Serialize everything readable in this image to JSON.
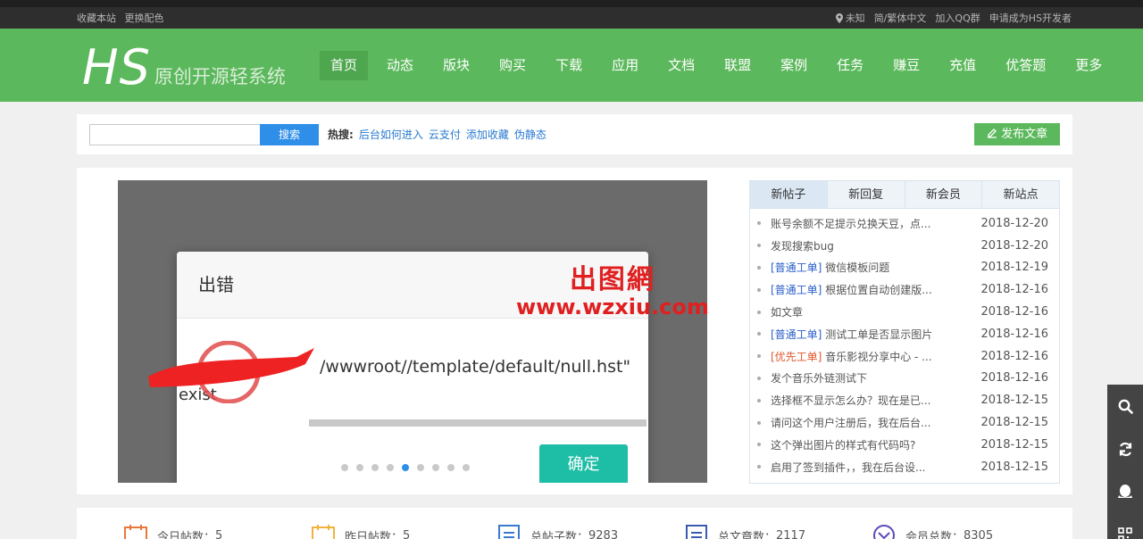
{
  "topbar": {
    "left": [
      "收藏本站",
      "更换配色"
    ],
    "location": "未知",
    "right": [
      "简/繁体中文",
      "加入QQ群",
      "申请成为HS开发者"
    ]
  },
  "logo": {
    "mark": "HS",
    "tagline": "原创开源轻系统"
  },
  "nav": [
    "首页",
    "动态",
    "版块",
    "购买",
    "下载",
    "应用",
    "文档",
    "联盟",
    "案例",
    "任务",
    "赚豆",
    "充值",
    "优答题",
    "更多"
  ],
  "search": {
    "placeholder": "",
    "button": "搜索",
    "hot_label": "热搜:",
    "hot_keywords": [
      "后台如何进入",
      "云支付",
      "添加收藏",
      "伪静态"
    ],
    "post_button": "发布文章"
  },
  "slider": {
    "dialog_title": "出错",
    "dialog_message": "/wwwroot//template/default/null.hst\"",
    "dialog_message_2": "exist",
    "ok_button": "确定",
    "dots_total": 9,
    "dots_active_index": 4,
    "watermark_1": "出图網",
    "watermark_2": "www.wzxiu.com"
  },
  "tabs": {
    "labels": [
      "新帖子",
      "新回复",
      "新会员",
      "新站点"
    ],
    "posts": [
      {
        "cat": "",
        "title": "账号余额不足提示兑换天豆，点...",
        "date": "2018-12-20"
      },
      {
        "cat": "",
        "title": "发现搜索bug",
        "date": "2018-12-20"
      },
      {
        "cat": "[普通工单]",
        "title": " 微信模板问题",
        "date": "2018-12-19"
      },
      {
        "cat": "[普通工单]",
        "title": " 根据位置自动创建版...",
        "date": "2018-12-16"
      },
      {
        "cat": "",
        "title": "如文章",
        "date": "2018-12-16"
      },
      {
        "cat": "[普通工单]",
        "title": " 测试工单是否显示图片",
        "date": "2018-12-16"
      },
      {
        "cat": "[优先工单]",
        "title": " 音乐影视分享中心 - ...",
        "date": "2018-12-16",
        "priority": true
      },
      {
        "cat": "",
        "title": "发个音乐外链测试下",
        "date": "2018-12-16"
      },
      {
        "cat": "",
        "title": "选择框不显示怎么办？现在是已...",
        "date": "2018-12-15"
      },
      {
        "cat": "",
        "title": "请问这个用户注册后，我在后台...",
        "date": "2018-12-15"
      },
      {
        "cat": "",
        "title": "这个弹出图片的样式有代码吗?",
        "date": "2018-12-15"
      },
      {
        "cat": "",
        "title": "启用了签到插件，，我在后台设...",
        "date": "2018-12-15"
      }
    ]
  },
  "stats": [
    {
      "label": "今日帖数：",
      "value": "5",
      "color": "#e8783a"
    },
    {
      "label": "昨日帖数：",
      "value": "5",
      "color": "#f0b43c"
    },
    {
      "label": "总帖子数：",
      "value": "9283",
      "color": "#3a7ad0"
    },
    {
      "label": "总文章数：",
      "value": "2117",
      "color": "#3a5ab0"
    },
    {
      "label": "会员总数：",
      "value": "8305",
      "color": "#5a4ab8"
    }
  ],
  "sidebar_icons": [
    "search-icon",
    "refresh-icon",
    "qq-icon",
    "qrcode-icon"
  ]
}
